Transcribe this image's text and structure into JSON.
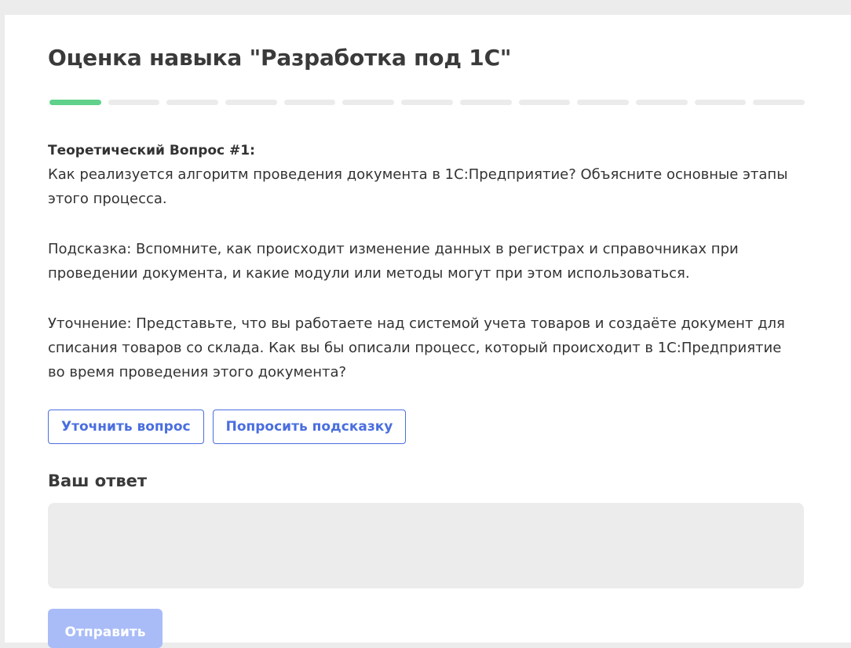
{
  "header": {
    "title": "Оценка навыка \"Разработка под 1С\""
  },
  "progress": {
    "total_steps": 13,
    "current_step": 1,
    "done_color": "#5fd18a",
    "todo_color": "#ebebeb"
  },
  "question": {
    "heading": "Теоретический Вопрос #1:",
    "text": "Как реализуется алгоритм проведения документа в 1С:Предприятие? Объясните основные этапы этого процесса.",
    "hint": "Подсказка: Вспомните, как происходит изменение данных в регистрах и справочниках при проведении документа, и какие модули или методы могут при этом использоваться.",
    "clarification": "Уточнение: Представьте, что вы работаете над системой учета товаров и создаёте документ для списания товаров со склада. Как вы бы описали процесс, который происходит в 1С:Предприятие во время проведения этого документа?"
  },
  "actions": {
    "clarify_label": "Уточнить вопрос",
    "hint_label": "Попросить подсказку",
    "accent_color": "#4a6ee0"
  },
  "answer": {
    "label": "Ваш ответ",
    "value": ""
  },
  "submit": {
    "label": "Отправить",
    "color": "#a9bcf7"
  }
}
